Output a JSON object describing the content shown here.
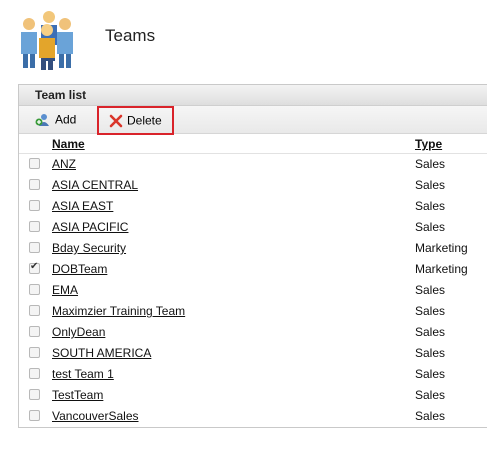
{
  "page": {
    "title": "Teams",
    "icon": "people-icon"
  },
  "panel": {
    "title": "Team list"
  },
  "toolbar": {
    "add_label": "Add",
    "delete_label": "Delete"
  },
  "columns": {
    "name": "Name",
    "type": "Type"
  },
  "teams": [
    {
      "name": "ANZ",
      "type": "Sales",
      "checked": false
    },
    {
      "name": "ASIA CENTRAL",
      "type": "Sales",
      "checked": false
    },
    {
      "name": "ASIA EAST",
      "type": "Sales",
      "checked": false
    },
    {
      "name": "ASIA PACIFIC",
      "type": "Sales",
      "checked": false
    },
    {
      "name": "Bday Security",
      "type": "Marketing",
      "checked": false
    },
    {
      "name": "DOBTeam",
      "type": "Marketing",
      "checked": true
    },
    {
      "name": "EMA",
      "type": "Sales",
      "checked": false
    },
    {
      "name": "Maximzier Training Team",
      "type": "Sales",
      "checked": false
    },
    {
      "name": "OnlyDean",
      "type": "Sales",
      "checked": false
    },
    {
      "name": "SOUTH AMERICA",
      "type": "Sales",
      "checked": false
    },
    {
      "name": "test Team 1",
      "type": "Sales",
      "checked": false
    },
    {
      "name": "TestTeam",
      "type": "Sales",
      "checked": false
    },
    {
      "name": "VancouverSales",
      "type": "Sales",
      "checked": false
    }
  ],
  "colors": {
    "delete_highlight": "#d9232a",
    "delete_icon": "#d9352a"
  }
}
